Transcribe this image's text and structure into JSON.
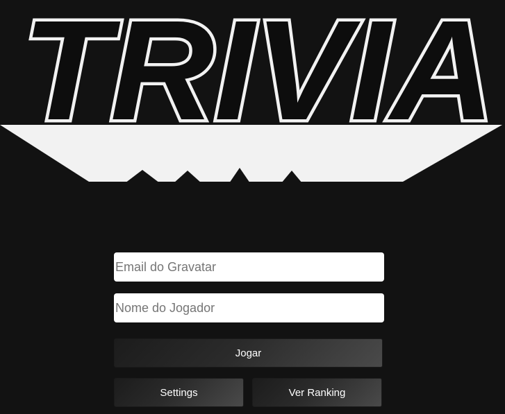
{
  "logo": {
    "text": "TRIVIA"
  },
  "form": {
    "email": {
      "placeholder": "Email do Gravatar",
      "value": ""
    },
    "name": {
      "placeholder": "Nome do Jogador",
      "value": ""
    },
    "play_label": "Jogar",
    "settings_label": "Settings",
    "ranking_label": "Ver Ranking"
  },
  "colors": {
    "background": "#121212",
    "logo_fill": "#0d0d0d",
    "logo_outline": "#f2f2f2",
    "input_bg": "#ffffff"
  }
}
